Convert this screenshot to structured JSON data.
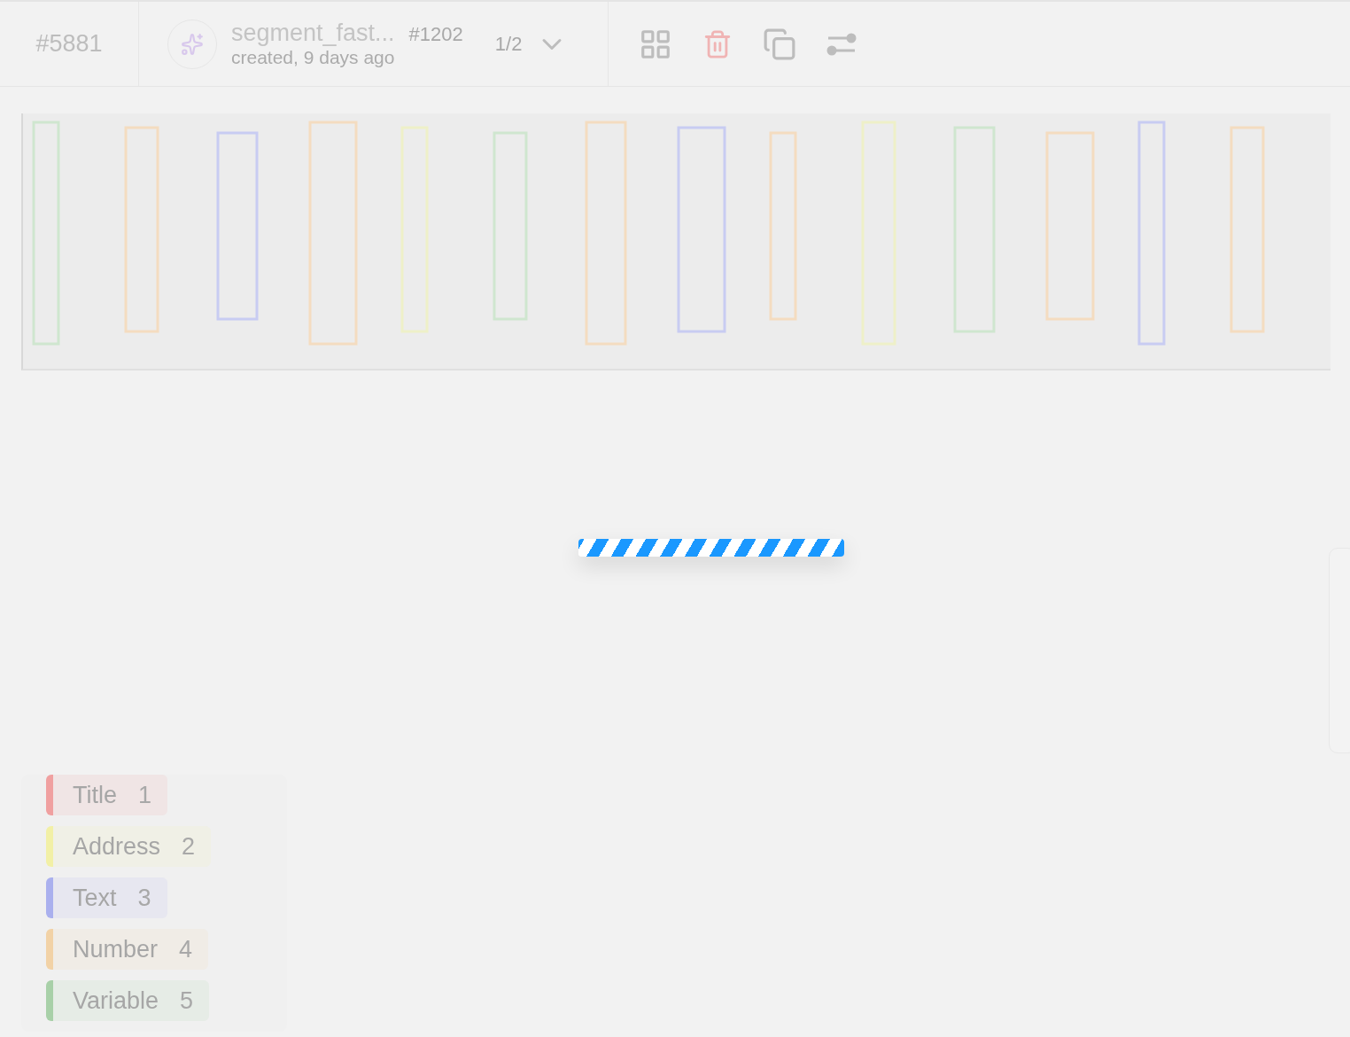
{
  "header": {
    "task_id": "#5881",
    "annotation": {
      "title": "segment_fast...",
      "number": "#1202",
      "meta": "created, 9 days ago"
    },
    "pager": "1/2"
  },
  "loading": {
    "level": 1
  },
  "labels": [
    {
      "name": "Title",
      "hotkey": "1",
      "color": "#f0a0a0"
    },
    {
      "name": "Address",
      "hotkey": "2",
      "color": "#f2f0a6"
    },
    {
      "name": "Text",
      "hotkey": "3",
      "color": "#aab0ee"
    },
    {
      "name": "Number",
      "hotkey": "4",
      "color": "#f2d2a6"
    },
    {
      "name": "Variable",
      "hotkey": "5",
      "color": "#a8d0a8"
    }
  ]
}
